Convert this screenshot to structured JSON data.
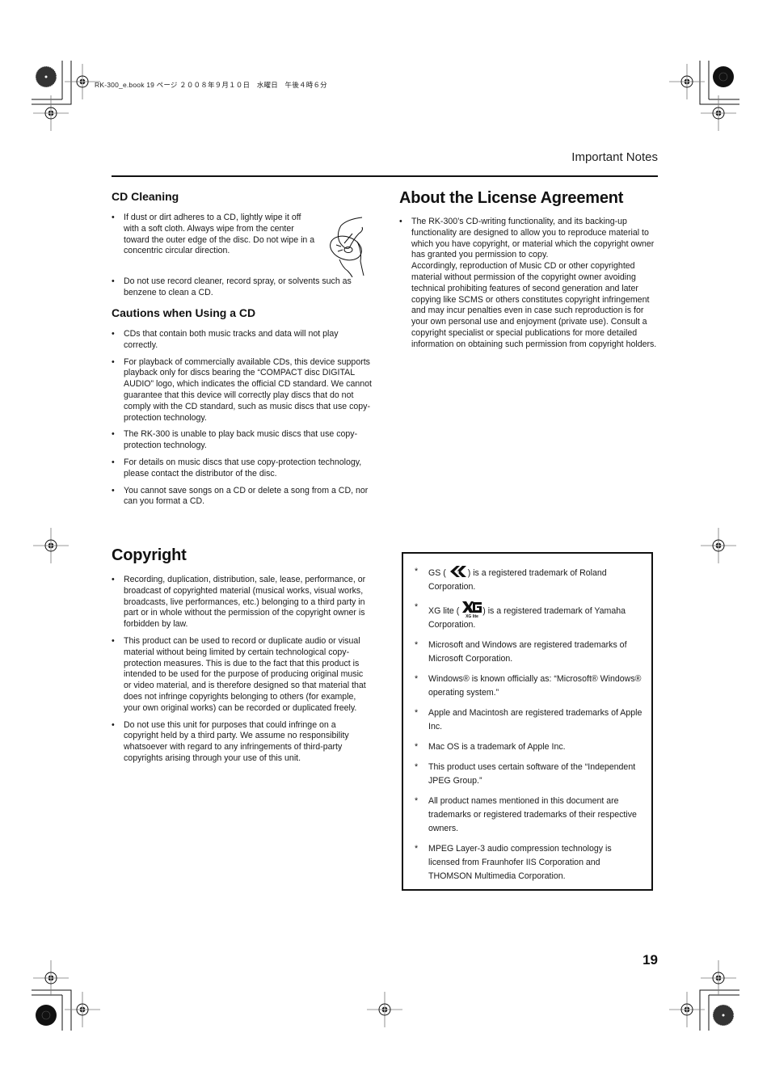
{
  "slug": {
    "text": "RK-300_e.book  19 ページ  ２００８年９月１０日　水曜日　午後４時６分"
  },
  "running_head": "Important Notes",
  "page_number": "19",
  "cd_cleaning": {
    "title": "CD Cleaning",
    "bullet_char": "•",
    "items": [
      "If dust or dirt adheres to a CD, lightly wipe it off with a soft cloth. Always wipe from the center toward the outer edge of the disc. Do not wipe in a concentric circular direction.",
      "Do not use record cleaner, record spray, or solvents such as benzene to clean a CD."
    ],
    "illustration": "hand-wiping-cd-illustration"
  },
  "cautions": {
    "title": "Cautions when Using a CD",
    "items": [
      "CDs that contain both music tracks and data will not play correctly.",
      "For playback of commercially available CDs, this device supports playback only for discs bearing the “COMPACT disc DIGITAL AUDIO” logo, which indicates the official CD standard. We cannot guarantee that this device will correctly play discs that do not comply with the CD standard, such as music discs that use copy-protection technology.",
      "The RK-300 is unable to play back music discs that use copy-protection technology.",
      "For details on music discs that use copy-protection technology, please contact the distributor of the disc.",
      "You cannot save songs on a CD or delete a song from a CD, nor can you format a CD."
    ]
  },
  "license": {
    "title": "About the License Agreement",
    "items": [
      "The RK-300’s CD-writing functionality, and its backing-up functionality are designed to allow you to reproduce material to which you have copyright, or material which the copyright owner has granted you permission to copy.",
      "Accordingly, reproduction of Music CD or other copyrighted material without permission of the copyright owner avoiding technical prohibiting features of second generation and later copying like SCMS or others constitutes copyright infringement and may incur penalties even in case such reproduction is for your own personal use and enjoyment (private use). Consult a copyright specialist or special publications for more detailed information on obtaining such permission from copyright holders."
    ]
  },
  "copyright": {
    "title": "Copyright",
    "items": [
      "Recording, duplication, distribution, sale, lease, performance, or broadcast of copyrighted material (musical works, visual works, broadcasts, live performances, etc.) belonging to a third party in part or in whole without the permission of the copyright owner is forbidden by law.",
      "This product can be used to record or duplicate audio or visual material without being limited by certain technological copy-protection measures. This is due to the fact that this product is intended to be used for the purpose of producing original music or video material, and is therefore designed so that material that does not infringe copyrights belonging to others (for example, your own original works) can be recorded or duplicated freely.",
      "Do not use this unit for purposes that could infringe on a copyright held by a third party. We assume no responsibility whatsoever with regard to any infringements of third-party copyrights arising through your use of this unit."
    ]
  },
  "trademarks": {
    "star_char": "*",
    "gs": {
      "before": "GS (",
      "after": ") is a registered trademark of Roland Corporation.",
      "logo": "gs-logo"
    },
    "xg": {
      "before": "XG lite (",
      "after": ") is a registered trademark of Yamaha Corporation.",
      "logo": "xg-lite-logo",
      "logo_caption": "XG lite"
    },
    "items": [
      "Microsoft and Windows are registered trademarks of Microsoft Corporation.",
      "Windows® is known officially as: “Microsoft® Windows® operating system.”",
      "Apple and Macintosh are registered trademarks of Apple Inc.",
      "Mac OS is a trademark of Apple Inc.",
      "This product uses certain software of the “Independent JPEG Group.”",
      "All product names mentioned in this document are trademarks or registered trademarks of their respective owners.",
      "MPEG Layer-3 audio compression technology is licensed from Fraunhofer IIS Corporation and THOMSON Multimedia Corporation."
    ]
  }
}
